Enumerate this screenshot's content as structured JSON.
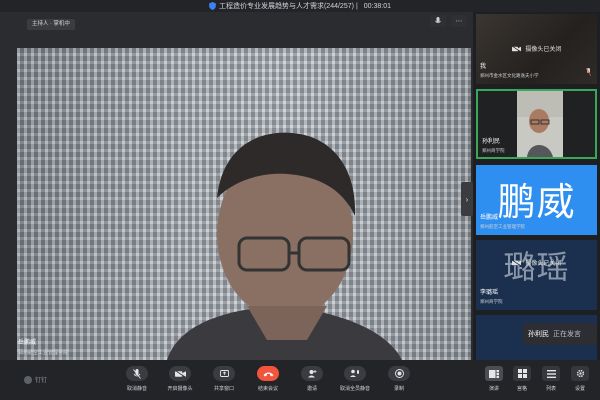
{
  "window": {
    "title": "工程造价专业发展趋势与人才需求(244/257)",
    "timer": "00:38:01"
  },
  "stage": {
    "host_badge": "主持人 · 掌机中",
    "speaker_name": "岳鹏威",
    "speaker_org": "郑州航空工业管理学院"
  },
  "participants": [
    {
      "name": "我",
      "org": "郑州市金水区文化路逸夫小学",
      "camera_status": "摄像头已关闭"
    },
    {
      "name": "孙利民",
      "org": "郑州商学院"
    },
    {
      "name": "岳鹏威",
      "org": "郑州航空工业管理学院",
      "avatar_text": "鹏威"
    },
    {
      "name": "李璐瑶",
      "org": "郑州商学院",
      "avatar_text": "璐瑶",
      "camera_status": "摄像头已关闭"
    }
  ],
  "speaking_indicator": {
    "name": "孙利民",
    "status": "正在发言"
  },
  "toolbar": {
    "logo": "钉钉",
    "left_items": [
      {
        "label": "取消静音",
        "icon": "mic-off-icon"
      },
      {
        "label": "开启摄像头",
        "icon": "camera-off-icon"
      },
      {
        "label": "共享窗口",
        "icon": "share-screen-icon"
      },
      {
        "label": "结束会议",
        "icon": "hangup-icon"
      },
      {
        "label": "邀请",
        "icon": "invite-icon"
      },
      {
        "label": "取消全员静音",
        "icon": "mute-all-icon"
      },
      {
        "label": "录制",
        "icon": "record-icon"
      }
    ],
    "right_items": [
      {
        "label": "演讲",
        "icon": "speaker-view-icon"
      },
      {
        "label": "宫格",
        "icon": "grid-view-icon"
      },
      {
        "label": "列表",
        "icon": "list-view-icon"
      },
      {
        "label": "设置",
        "icon": "settings-icon"
      }
    ]
  },
  "colors": {
    "end_call": "#f2543d",
    "active_border": "#3aa657",
    "avatar_blue": "#2f8ff0",
    "avatar_dark": "#1b2f4e"
  }
}
